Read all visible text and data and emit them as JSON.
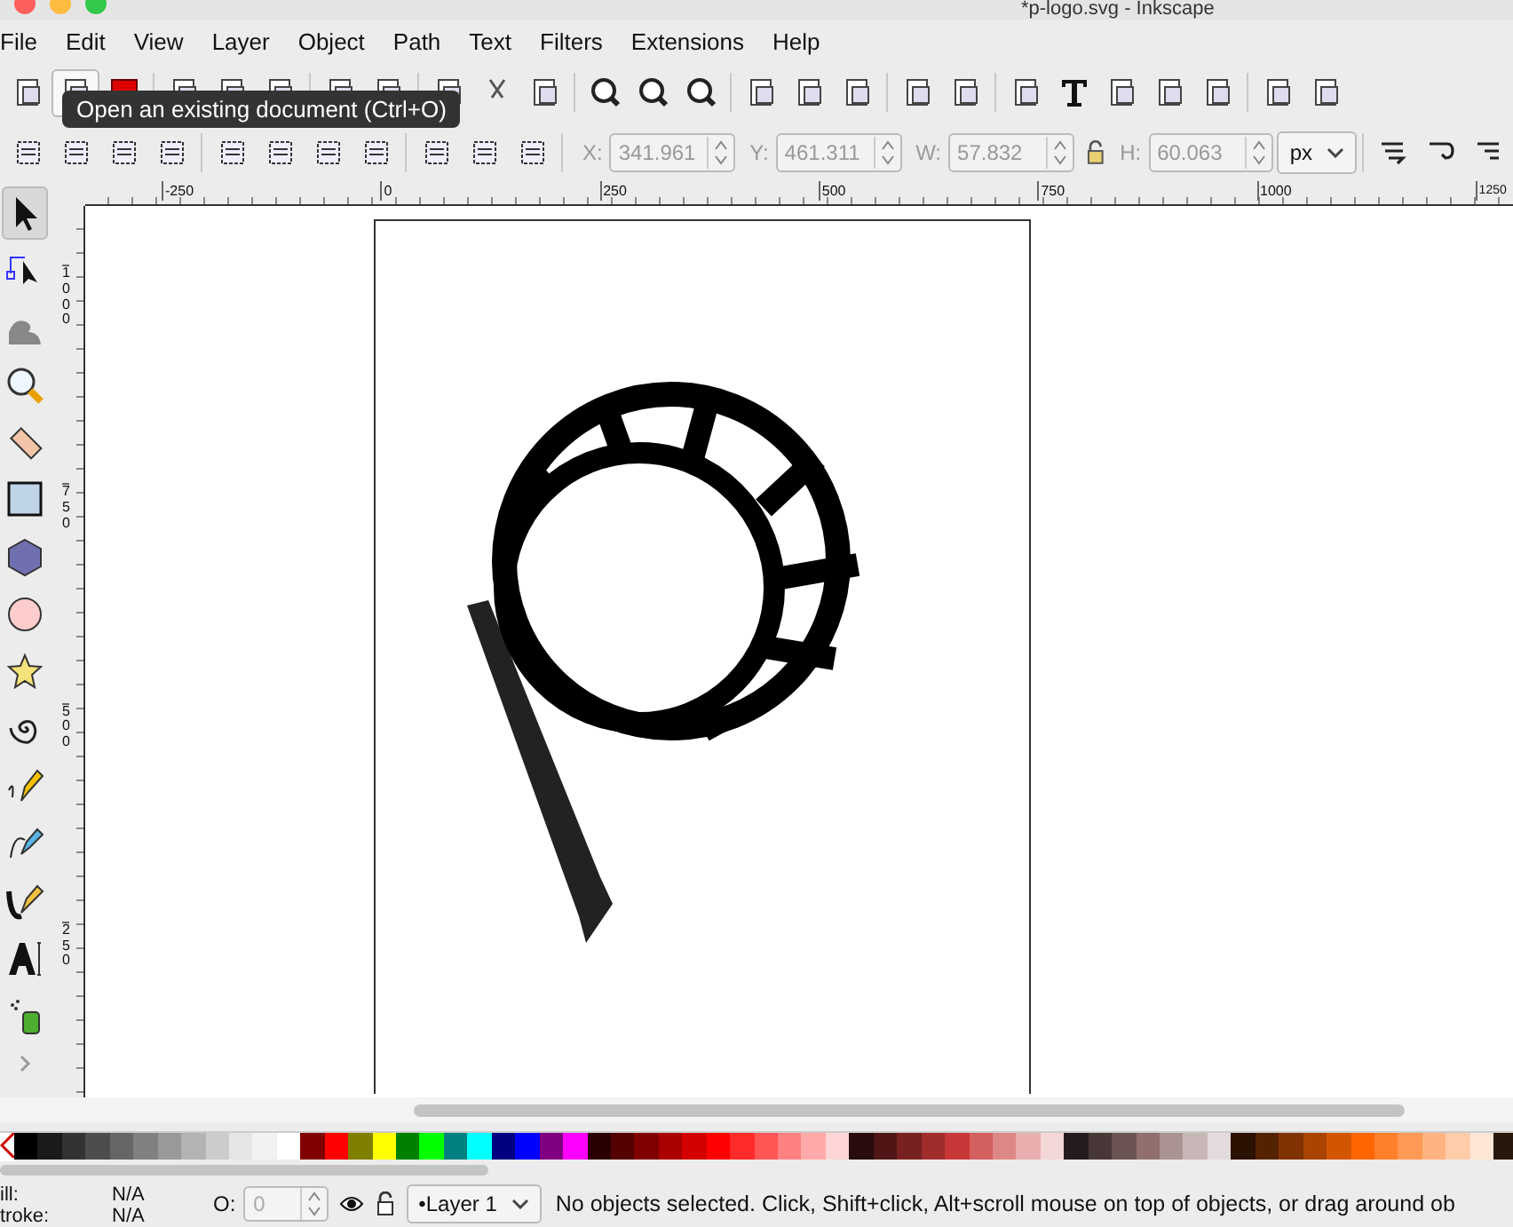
{
  "window": {
    "title": "*p-logo.svg - Inkscape"
  },
  "menu": [
    "File",
    "Edit",
    "View",
    "Layer",
    "Object",
    "Path",
    "Text",
    "Filters",
    "Extensions",
    "Help"
  ],
  "tooltip": "Open an existing document (Ctrl+O)",
  "controls": {
    "fields": [
      {
        "label": "X:",
        "value": "341.961"
      },
      {
        "label": "Y:",
        "value": "461.311"
      },
      {
        "label": "W:",
        "value": "57.832"
      },
      {
        "label": "H:",
        "value": "60.063"
      }
    ],
    "unit": "px"
  },
  "ruler_h": [
    "-250",
    "0",
    "250",
    "500",
    "750",
    "1000",
    "1250"
  ],
  "ruler_v": [
    "1000",
    "750",
    "500",
    "250"
  ],
  "tools": [
    {
      "kind": "selector",
      "selected": true
    },
    {
      "kind": "node",
      "selected": false
    },
    {
      "kind": "tweak",
      "selected": false
    },
    {
      "kind": "zoom",
      "selected": false
    },
    {
      "kind": "measure",
      "selected": false
    },
    {
      "kind": "rect",
      "selected": false
    },
    {
      "kind": "box",
      "selected": false
    },
    {
      "kind": "ellipse",
      "selected": false
    },
    {
      "kind": "star",
      "selected": false
    },
    {
      "kind": "spiral",
      "selected": false
    },
    {
      "kind": "pencil",
      "selected": false
    },
    {
      "kind": "pen",
      "selected": false
    },
    {
      "kind": "calligraphy",
      "selected": false
    },
    {
      "kind": "text",
      "selected": false
    },
    {
      "kind": "spray",
      "selected": false
    }
  ],
  "palette": [
    {
      "color": "#000000"
    },
    {
      "color": "#1a1a1a"
    },
    {
      "color": "#333333"
    },
    {
      "color": "#4d4d4d"
    },
    {
      "color": "#666666"
    },
    {
      "color": "#808080"
    },
    {
      "color": "#999999"
    },
    {
      "color": "#b3b3b3"
    },
    {
      "color": "#cccccc"
    },
    {
      "color": "#e6e6e6"
    },
    {
      "color": "#f2f2f2"
    },
    {
      "color": "#ffffff"
    },
    {
      "color": "#800000"
    },
    {
      "color": "#ff0000"
    },
    {
      "color": "#808000"
    },
    {
      "color": "#ffff00"
    },
    {
      "color": "#008000"
    },
    {
      "color": "#00ff00"
    },
    {
      "color": "#008080"
    },
    {
      "color": "#00ffff"
    },
    {
      "color": "#000080"
    },
    {
      "color": "#0000ff"
    },
    {
      "color": "#800080"
    },
    {
      "color": "#ff00ff"
    },
    {
      "color": "#2b0000"
    },
    {
      "color": "#550000"
    },
    {
      "color": "#800001"
    },
    {
      "color": "#aa0000"
    },
    {
      "color": "#d40000"
    },
    {
      "color": "#ff0001"
    },
    {
      "color": "#ff2a2a"
    },
    {
      "color": "#ff5555"
    },
    {
      "color": "#ff8080"
    },
    {
      "color": "#ffaaaa"
    },
    {
      "color": "#ffd5d5"
    },
    {
      "color": "#280b0b"
    },
    {
      "color": "#501616"
    },
    {
      "color": "#782121"
    },
    {
      "color": "#a02c2c"
    },
    {
      "color": "#c83737"
    },
    {
      "color": "#d35f5f"
    },
    {
      "color": "#de8787"
    },
    {
      "color": "#e9afaf"
    },
    {
      "color": "#f4d7d7"
    },
    {
      "color": "#241c1c"
    },
    {
      "color": "#483737"
    },
    {
      "color": "#6c5353"
    },
    {
      "color": "#916f6f"
    },
    {
      "color": "#ac9393"
    },
    {
      "color": "#c8b7b7"
    },
    {
      "color": "#e3dbdb"
    },
    {
      "color": "#2b1100"
    },
    {
      "color": "#552200"
    },
    {
      "color": "#803300"
    },
    {
      "color": "#aa4400"
    },
    {
      "color": "#d45500"
    },
    {
      "color": "#ff6600"
    },
    {
      "color": "#ff7f2a"
    },
    {
      "color": "#ff9955"
    },
    {
      "color": "#ffb380"
    },
    {
      "color": "#ffccaa"
    },
    {
      "color": "#ffe6d5"
    },
    {
      "color": "#28170b"
    }
  ],
  "status": {
    "fill_label": "ill:",
    "fill": "N/A",
    "stroke_label": "troke:",
    "stroke": "N/A",
    "opacity_label": "O:",
    "opacity": "0",
    "layer": "•Layer 1",
    "message": "No objects selected. Click, Shift+click, Alt+scroll mouse on top of objects, or drag around ob"
  }
}
